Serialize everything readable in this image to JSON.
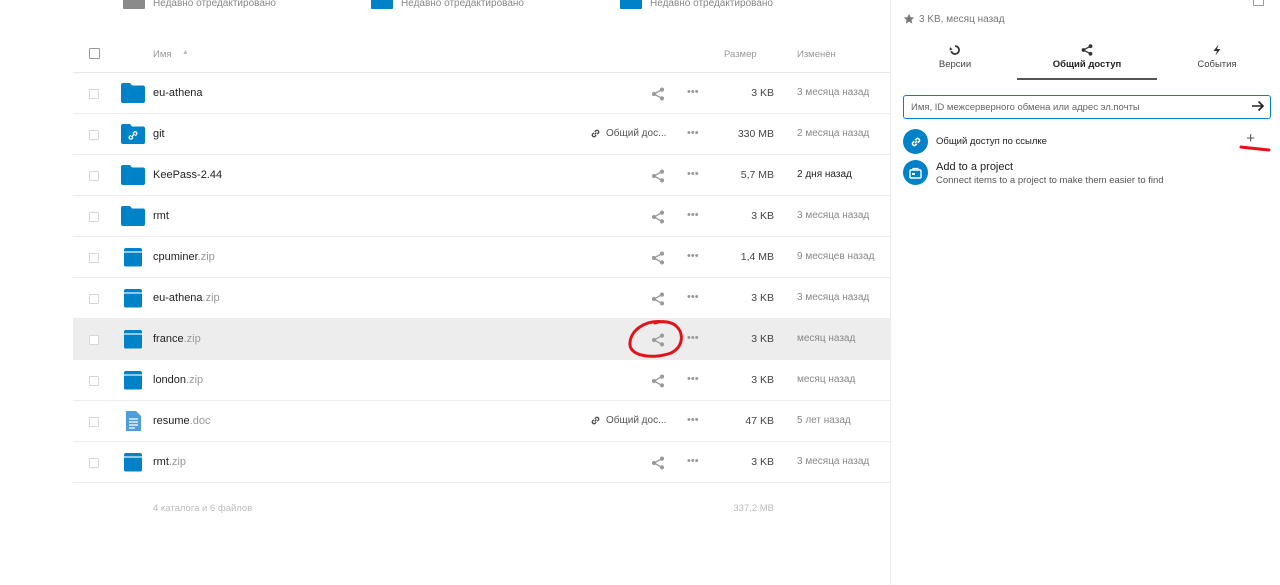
{
  "recent_strip": [
    {
      "label": "Недавно отредактировано",
      "thumb_color": "#8a8a8a"
    },
    {
      "label": "Недавно отредактировано",
      "thumb_color": "#0082c9"
    },
    {
      "label": "Недавно отредактировано",
      "thumb_color": "#0082c9"
    }
  ],
  "file_list": {
    "header": {
      "name": "Имя",
      "size": "Размер",
      "modified": "Изменён"
    },
    "rows": [
      {
        "name": "eu-athena",
        "ext": "",
        "type": "folder",
        "shared_label": "",
        "size": "3 KB",
        "modified": "3 месяца назад",
        "selected": false,
        "recent": false
      },
      {
        "name": "git",
        "ext": "",
        "type": "folder-linked",
        "shared_label": "Общий дос...",
        "size": "330 MB",
        "modified": "2 месяца назад",
        "selected": false,
        "recent": false
      },
      {
        "name": "KeePass-2.44",
        "ext": "",
        "type": "folder",
        "shared_label": "",
        "size": "5,7 MB",
        "modified": "2 дня назад",
        "selected": false,
        "recent": true
      },
      {
        "name": "rmt",
        "ext": "",
        "type": "folder",
        "shared_label": "",
        "size": "3 KB",
        "modified": "3 месяца назад",
        "selected": false,
        "recent": false
      },
      {
        "name": "cpuminer",
        "ext": ".zip",
        "type": "archive",
        "shared_label": "",
        "size": "1,4 MB",
        "modified": "9 месяцев назад",
        "selected": false,
        "recent": false
      },
      {
        "name": "eu-athena",
        "ext": ".zip",
        "type": "archive",
        "shared_label": "",
        "size": "3 KB",
        "modified": "3 месяца назад",
        "selected": false,
        "recent": false
      },
      {
        "name": "france",
        "ext": ".zip",
        "type": "archive",
        "shared_label": "",
        "size": "3 KB",
        "modified": "месяц назад",
        "selected": true,
        "recent": false
      },
      {
        "name": "london",
        "ext": ".zip",
        "type": "archive",
        "shared_label": "",
        "size": "3 KB",
        "modified": "месяц назад",
        "selected": false,
        "recent": false
      },
      {
        "name": "resume",
        "ext": ".doc",
        "type": "document",
        "shared_label": "Общий дос...",
        "size": "47 KB",
        "modified": "5 лет назад",
        "selected": false,
        "recent": false
      },
      {
        "name": "rmt",
        "ext": ".zip",
        "type": "archive",
        "shared_label": "",
        "size": "3 KB",
        "modified": "3 месяца назад",
        "selected": false,
        "recent": false
      }
    ],
    "summary": {
      "count": "4 каталога и 6 файлов",
      "total_size": "337,2 MB"
    }
  },
  "sidebar": {
    "meta": "3 KB, месяц назад",
    "tabs": [
      {
        "label": "Версии",
        "icon": "history-icon"
      },
      {
        "label": "Общий доступ",
        "icon": "share-icon",
        "active": true
      },
      {
        "label": "События",
        "icon": "activity-icon"
      }
    ],
    "share_input_placeholder": "Имя, ID межсерверного обмена или адрес эл.почты",
    "link_share_label": "Общий доступ по ссылке",
    "project_title": "Add to a project",
    "project_subtitle": "Connect items to a project to make them easier to find"
  },
  "colors": {
    "accent": "#0082c9",
    "annotation": "#e0141b",
    "selected_row": "#ededed"
  }
}
